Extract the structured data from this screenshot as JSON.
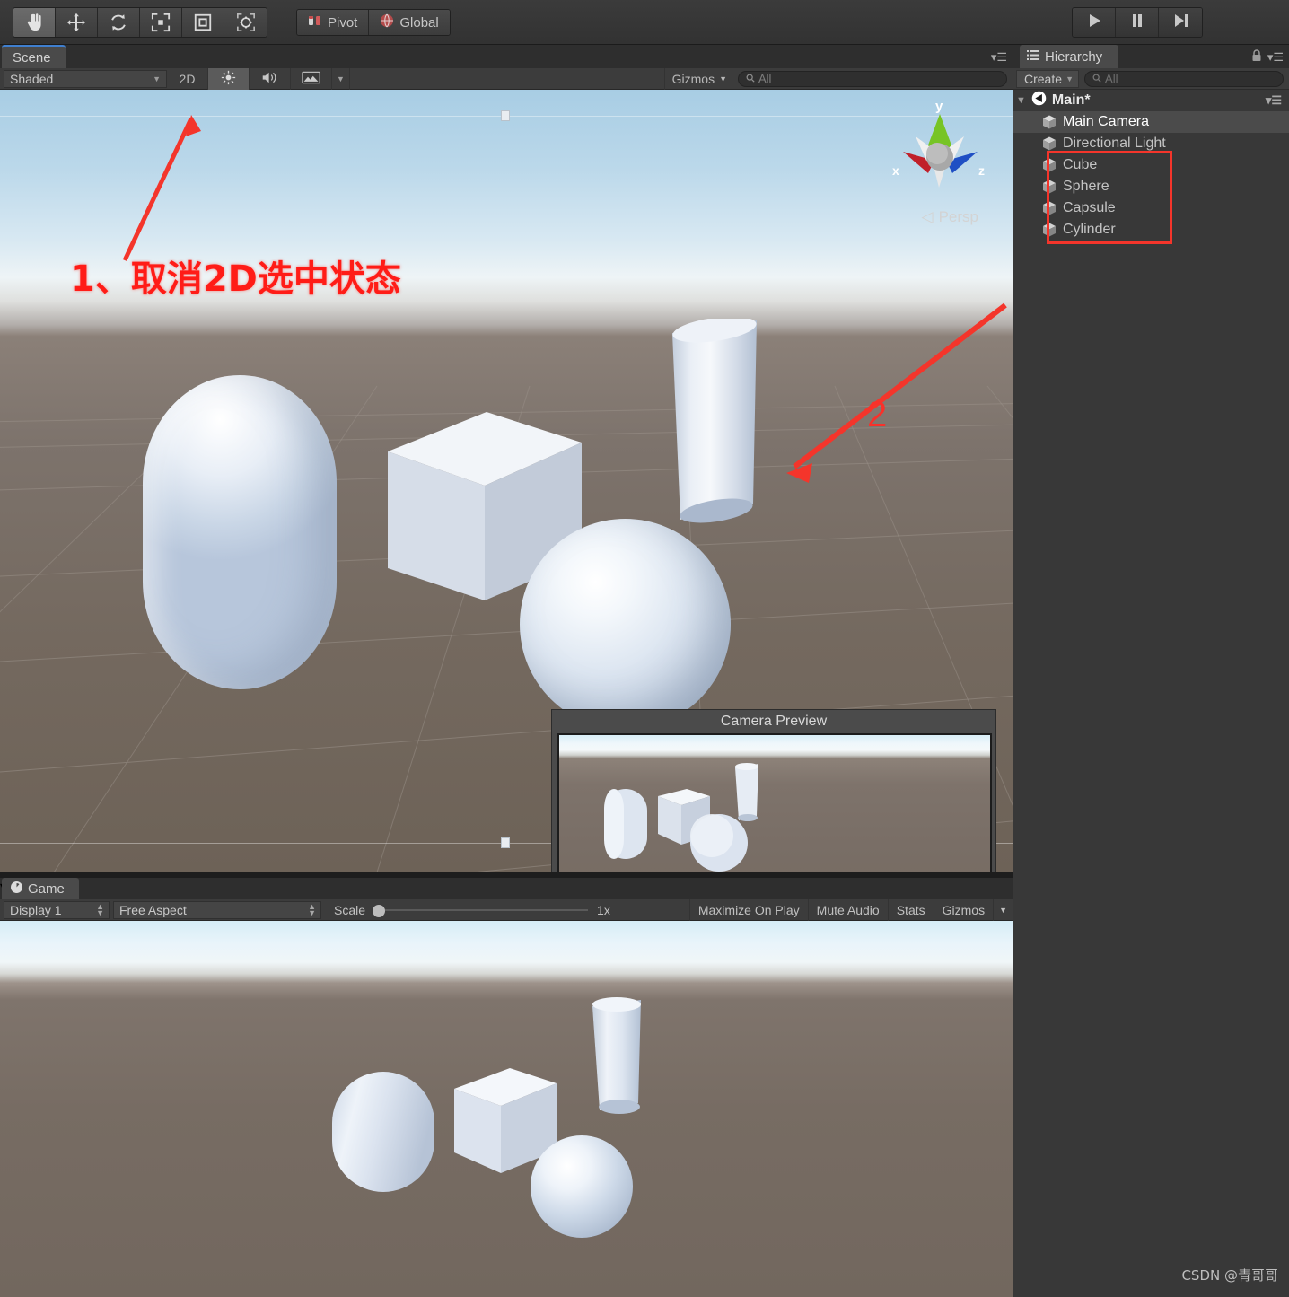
{
  "toolbar": {
    "tools": [
      {
        "name": "hand-tool",
        "icon": "hand-icon",
        "active": true
      },
      {
        "name": "move-tool",
        "icon": "move-arrows-icon",
        "active": false
      },
      {
        "name": "rotate-tool",
        "icon": "rotate-icon",
        "active": false
      },
      {
        "name": "scale-tool",
        "icon": "scale-icon",
        "active": false
      },
      {
        "name": "rect-tool",
        "icon": "rect-transform-icon",
        "active": false
      },
      {
        "name": "transform-tool",
        "icon": "combined-transform-icon",
        "active": false
      }
    ],
    "pivot_label": "Pivot",
    "handle_label": "Global",
    "play_label": "play-button",
    "pause_label": "pause-button",
    "step_label": "step-button"
  },
  "scene": {
    "tab_label": "Scene",
    "draw_mode": "Shaded",
    "toggle_2d": "2D",
    "lighting_icon": "sun-icon",
    "audio_icon": "speaker-icon",
    "fx_icon": "image-effects-icon",
    "gizmos_label": "Gizmos",
    "search_placeholder": "All",
    "search_value": "",
    "search_icon": "search-icon",
    "persp_label": "Persp",
    "axis_x": "x",
    "axis_y": "y",
    "axis_z": "z",
    "menu_icon": "panel-menu-icon"
  },
  "camera_preview": {
    "title": "Camera Preview"
  },
  "annotations": {
    "step1_text": "1、取消2D选中状态",
    "step2_text": "2",
    "color": "#f8312a"
  },
  "game": {
    "tab_label": "Game",
    "display": "Display 1",
    "aspect": "Free Aspect",
    "scale_label": "Scale",
    "scale_value": "1x",
    "maximize_label": "Maximize On Play",
    "mute_label": "Mute Audio",
    "stats_label": "Stats",
    "gizmos_label": "Gizmos"
  },
  "hierarchy": {
    "tab_label": "Hierarchy",
    "tab_icon": "hierarchy-list-icon",
    "lock_icon": "lock-icon",
    "menu_icon": "panel-menu-icon",
    "create_label": "Create",
    "search_placeholder": "All",
    "search_value": "",
    "search_icon": "search-icon",
    "scene_name": "Main*",
    "items": [
      {
        "label": "Main Camera",
        "selected": true,
        "highlighted": false
      },
      {
        "label": "Directional Light",
        "selected": false,
        "highlighted": false
      },
      {
        "label": "Cube",
        "selected": false,
        "highlighted": true
      },
      {
        "label": "Sphere",
        "selected": false,
        "highlighted": true
      },
      {
        "label": "Capsule",
        "selected": false,
        "highlighted": true
      },
      {
        "label": "Cylinder",
        "selected": false,
        "highlighted": true
      }
    ]
  },
  "watermark": {
    "text": "CSDN @青哥哥"
  },
  "colors": {
    "panel_bg": "#383838",
    "toolbar_bg": "#3c3c3c",
    "accent_tab": "#3f7fcf",
    "annotation_red": "#f4352b",
    "selection_row": "#4b4b4b"
  }
}
